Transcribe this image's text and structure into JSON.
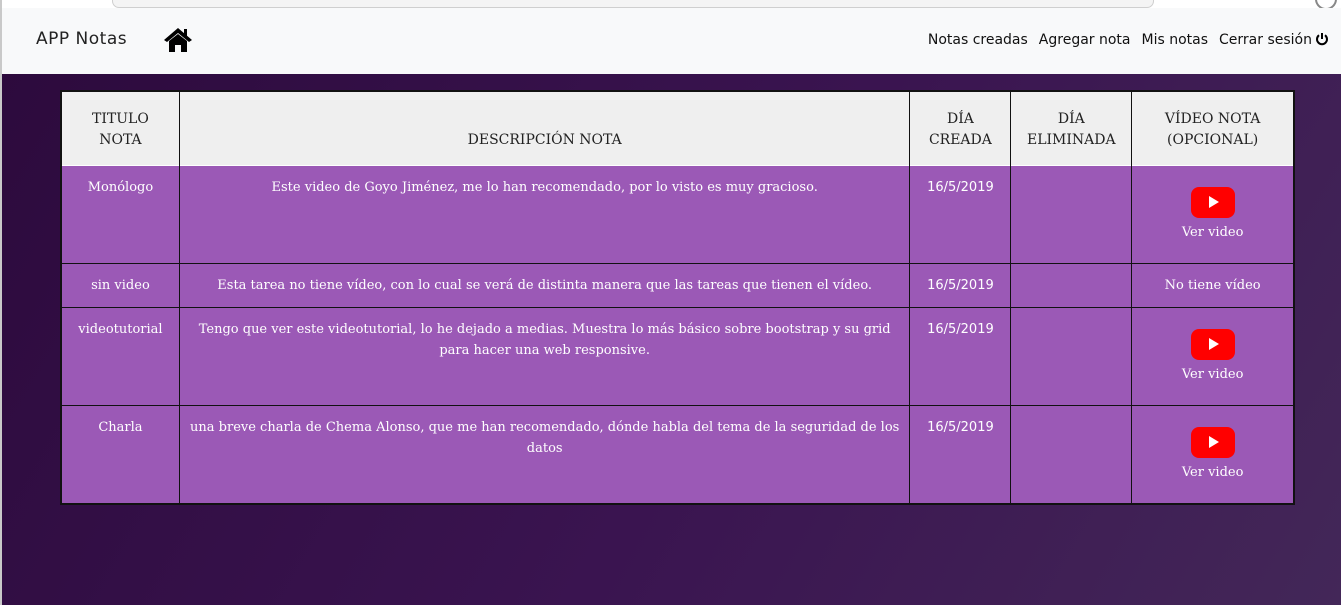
{
  "app": {
    "brand": "APP Notas"
  },
  "nav": {
    "links": [
      "Notas creadas",
      "Agregar nota",
      "Mis notas",
      "Cerrar sesión"
    ]
  },
  "icons": {
    "home": "home-icon",
    "logout": "power-icon",
    "video": "youtube-play-icon"
  },
  "colors": {
    "row_bg": "#9b59b6",
    "header_bg": "#efefef",
    "youtube": "#ff0000"
  },
  "table": {
    "headers": {
      "titulo_1": "TITULO",
      "titulo_2": "NOTA",
      "descripcion": "DESCRIPCIÓN NOTA",
      "creada_1": "DÍA",
      "creada_2": "CREADA",
      "eliminada_1": "DÍA",
      "eliminada_2": "ELIMINADA",
      "video_1": "VÍDEO NOTA",
      "video_2": "(OPCIONAL)"
    },
    "rows": [
      {
        "titulo": "Monólogo",
        "descripcion": "Este video de Goyo Jiménez, me lo han recomendado, por lo visto es muy gracioso.",
        "creada": "16/5/2019",
        "eliminada": "",
        "video": "Ver video"
      },
      {
        "titulo": "sin video",
        "descripcion": "Esta tarea no tiene vídeo, con lo cual se verá de distinta manera que las tareas que tienen el vídeo.",
        "creada": "16/5/2019",
        "eliminada": "",
        "video": "No tiene vídeo"
      },
      {
        "titulo": "videotutorial",
        "descripcion": "Tengo que ver este videotutorial, lo he dejado a medias. Muestra lo más básico sobre bootstrap y su grid para hacer una web responsive.",
        "creada": "16/5/2019",
        "eliminada": "",
        "video": "Ver video"
      },
      {
        "titulo": "Charla",
        "descripcion": "una breve charla de Chema Alonso, que me han recomendado, dónde habla del tema de la seguridad de los datos",
        "creada": "16/5/2019",
        "eliminada": "",
        "video": "Ver video"
      }
    ]
  }
}
